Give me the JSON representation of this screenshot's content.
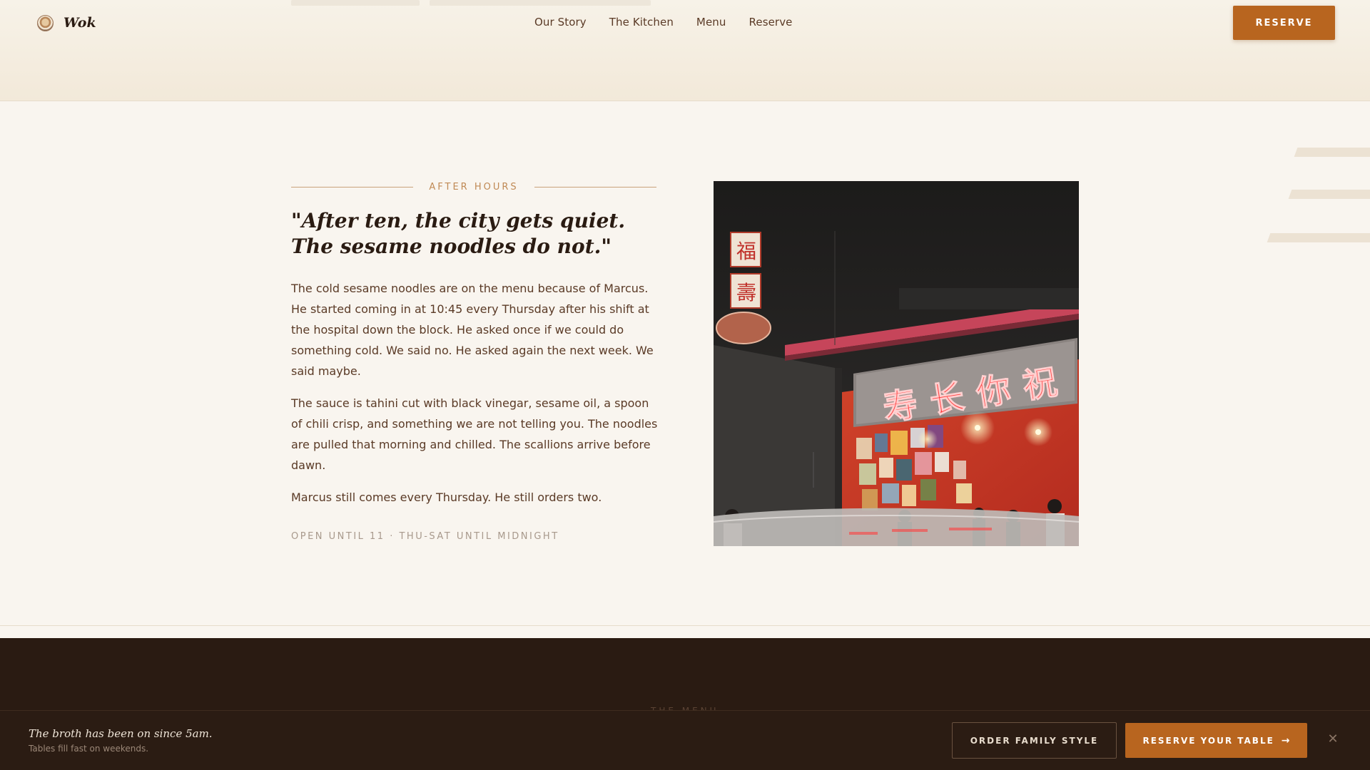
{
  "header": {
    "brand_name": "Wok",
    "nav": [
      {
        "label": "Our Story"
      },
      {
        "label": "The Kitchen"
      },
      {
        "label": "Menu"
      },
      {
        "label": "Reserve"
      }
    ],
    "reserve_label": "RESERVE"
  },
  "story": {
    "eyebrow": "AFTER HOURS",
    "quote": "\"After ten, the city gets quiet. The sesame noodles do not.\"",
    "paragraphs": [
      "The cold sesame noodles are on the menu because of Marcus. He started coming in at 10:45 every Thursday after his shift at the hospital down the block. He asked once if we could do something cold. We said no. He asked again the next week. We said maybe.",
      "The sauce is tahini cut with black vinegar, sesame oil, a spoon of chili crisp, and something we are not telling you. The noodles are pulled that morning and chilled. The scallions arrive before dawn.",
      "Marcus still comes every Thursday. He still orders two."
    ],
    "hours": "OPEN UNTIL 11 · THU-SAT UNTIL MIDNIGHT"
  },
  "photo": {
    "sign_main": "寿长你祝",
    "sign_vertical_1": "福",
    "sign_vertical_2": "壽"
  },
  "menu_band": {
    "eyebrow": "THE MENU"
  },
  "sticky_bar": {
    "title": "The broth has been on since 5am.",
    "subtitle": "Tables fill fast on weekends.",
    "order_label": "ORDER FAMILY STYLE",
    "reserve_label": "RESERVE YOUR TABLE",
    "arrow_icon": "arrow-right-icon",
    "close_icon": "close-icon"
  },
  "colors": {
    "accent": "#b8651f",
    "cream": "#f9f5ef",
    "dark": "#2a1b12",
    "text": "#5a3a26"
  }
}
